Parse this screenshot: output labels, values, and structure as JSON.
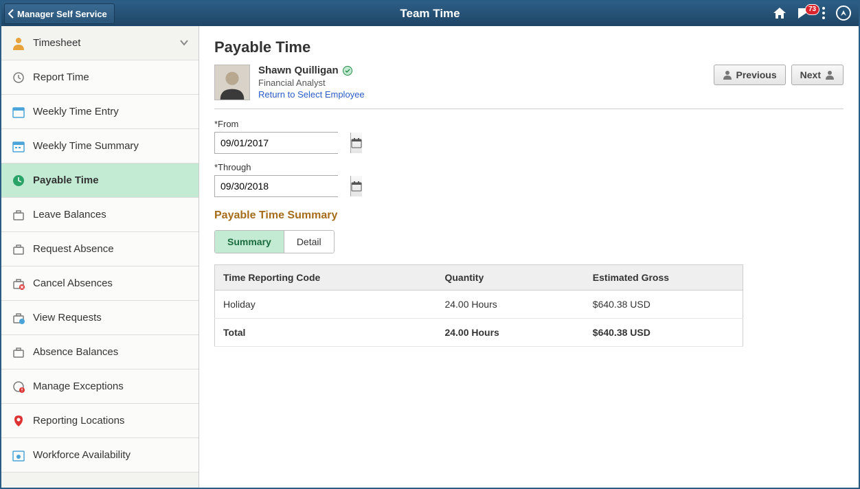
{
  "banner": {
    "back_label": "Manager Self Service",
    "title": "Team Time",
    "notif_count": "73"
  },
  "sidebar": {
    "header": "Timesheet",
    "items": [
      {
        "id": "report-time",
        "label": "Report Time"
      },
      {
        "id": "weekly-time-entry",
        "label": "Weekly Time Entry"
      },
      {
        "id": "weekly-time-summary",
        "label": "Weekly Time Summary"
      },
      {
        "id": "payable-time",
        "label": "Payable Time",
        "active": true
      },
      {
        "id": "leave-balances",
        "label": "Leave Balances"
      },
      {
        "id": "request-absence",
        "label": "Request Absence"
      },
      {
        "id": "cancel-absences",
        "label": "Cancel Absences"
      },
      {
        "id": "view-requests",
        "label": "View Requests"
      },
      {
        "id": "absence-balances",
        "label": "Absence Balances"
      },
      {
        "id": "manage-exceptions",
        "label": "Manage Exceptions"
      },
      {
        "id": "reporting-locations",
        "label": "Reporting Locations"
      },
      {
        "id": "workforce-availability",
        "label": "Workforce Availability"
      }
    ]
  },
  "page": {
    "title": "Payable Time",
    "employee": {
      "name": "Shawn Quilligan",
      "role": "Financial Analyst",
      "return_link": "Return to Select Employee"
    },
    "nav": {
      "prev": "Previous",
      "next": "Next"
    },
    "from_label": "*From",
    "through_label": "*Through",
    "from_value": "09/01/2017",
    "through_value": "09/30/2018",
    "section_heading": "Payable Time Summary",
    "tabs": {
      "summary": "Summary",
      "detail": "Detail"
    },
    "table": {
      "headers": {
        "code": "Time Reporting Code",
        "qty": "Quantity",
        "gross": "Estimated Gross"
      },
      "rows": [
        {
          "code": "Holiday",
          "qty": "24.00 Hours",
          "gross": "$640.38 USD"
        }
      ],
      "total": {
        "code": "Total",
        "qty": "24.00 Hours",
        "gross": "$640.38 USD"
      }
    }
  }
}
